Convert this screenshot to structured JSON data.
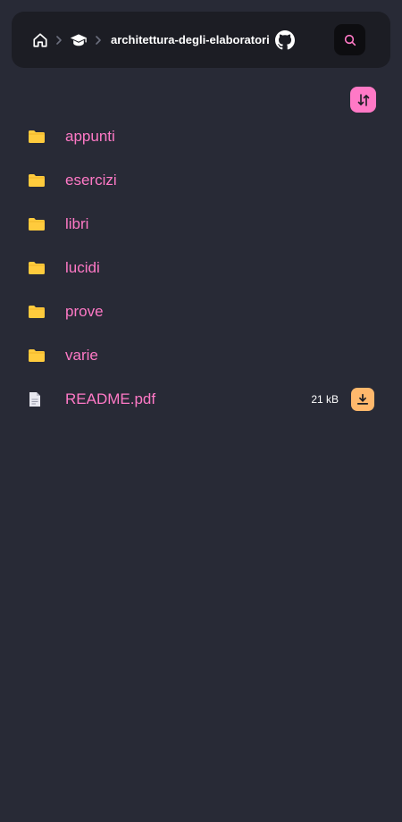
{
  "navbar": {
    "home_icon": "home-icon",
    "separator_icon": "chevron-right-icon",
    "course_icon": "graduation-cap-icon",
    "breadcrumb_label": "architettura-degli-elaboratori",
    "github_icon": "github-icon",
    "search_icon": "search-icon"
  },
  "toolbar": {
    "sort_icon": "sort-icon"
  },
  "colors": {
    "background": "#282a36",
    "navbar": "#1c1d24",
    "accent": "#ff79c6",
    "folder": "#ffcb3d",
    "download": "#ffb86c"
  },
  "entries": [
    {
      "name": "appunti",
      "kind": "folder"
    },
    {
      "name": "esercizi",
      "kind": "folder"
    },
    {
      "name": "libri",
      "kind": "folder"
    },
    {
      "name": "lucidi",
      "kind": "folder"
    },
    {
      "name": "prove",
      "kind": "folder"
    },
    {
      "name": "varie",
      "kind": "folder"
    },
    {
      "name": "README.pdf",
      "kind": "file",
      "size": "21 kB",
      "action_icon": "download-icon"
    }
  ]
}
